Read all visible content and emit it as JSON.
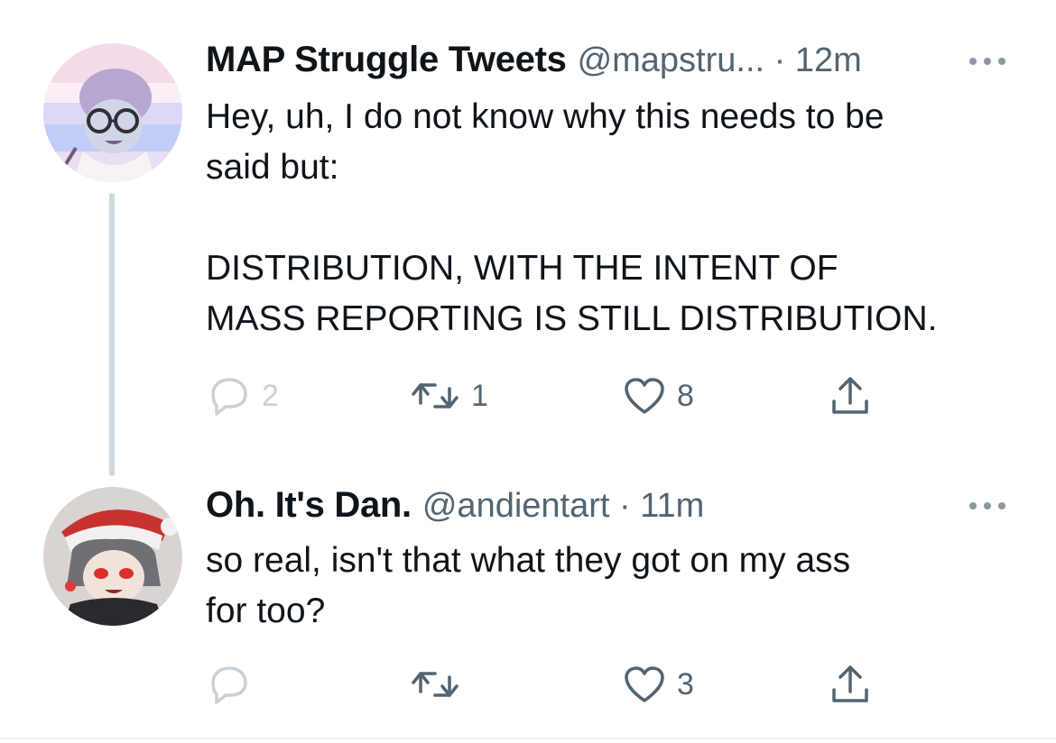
{
  "tweets": [
    {
      "author_name": "MAP Struggle Tweets",
      "meta": "@mapstru... · 12m",
      "text": "Hey, uh, I do not know why this needs to be\nsaid but:\n\nDISTRIBUTION, WITH THE INTENT OF\nMASS REPORTING IS STILL DISTRIBUTION.",
      "replies": "2",
      "retweets": "1",
      "likes": "8"
    },
    {
      "author_name": "Oh. It's Dan.",
      "meta": "@andientart · 11m",
      "text": "so real, isn't that what they got on my ass\nfor too?",
      "replies": "",
      "retweets": "",
      "likes": "3"
    }
  ],
  "colors": {
    "text_primary": "#0f1419",
    "text_secondary": "#536471",
    "thread_line": "#cfd9de",
    "icon": "#536471"
  },
  "icons": [
    "more-icon",
    "reply-icon",
    "retweet-icon",
    "like-icon",
    "share-icon"
  ]
}
